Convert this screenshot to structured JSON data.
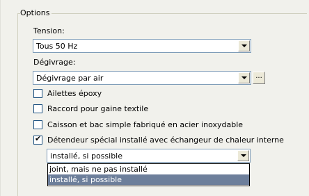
{
  "group": {
    "legend": "Options"
  },
  "tension": {
    "label": "Tension:",
    "value": "Tous 50 Hz"
  },
  "degivrage": {
    "label": "Dégivrage:",
    "value": "Dégivrage par air",
    "more_button": "..."
  },
  "checkboxes": [
    {
      "label": "Ailettes époxy",
      "checked": false
    },
    {
      "label": "Raccord pour gaine textile",
      "checked": false
    },
    {
      "label": "Caisson et bac simple fabriqué en acier inoxydable",
      "checked": false
    },
    {
      "label": "Détendeur spécial installé avec échangeur de chaleur interne",
      "checked": true
    }
  ],
  "detendeur": {
    "value": "installé, si possible",
    "options": [
      "joint, mais ne pas installé",
      "installé, si possible"
    ],
    "selected_index": 1
  }
}
